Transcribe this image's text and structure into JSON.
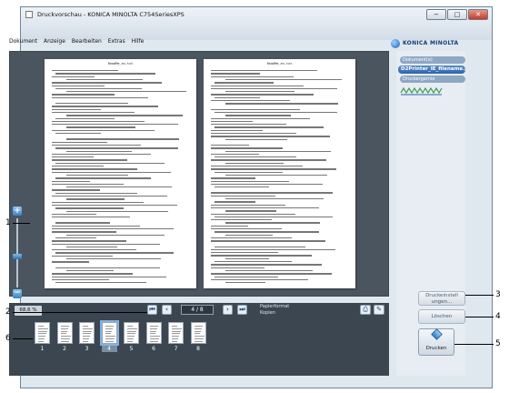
{
  "window": {
    "title": "Druckvorschau - KONICA MINOLTA C754SeriesXPS"
  },
  "window_buttons": {
    "minimize": "−",
    "maximize": "□",
    "close": "✕"
  },
  "menu": [
    "Dokument",
    "Anzeige",
    "Bearbeiten",
    "Extras",
    "Hilfe"
  ],
  "brand": {
    "logo_text": "KONICA MINOLTA"
  },
  "viewer": {
    "page_left": {
      "header": "ReadMe_en.txt"
    },
    "page_right": {
      "header": "ReadMe_en.txt"
    }
  },
  "zoom": {
    "plus": "+",
    "minus": "−",
    "readout": "68,6 %",
    "level_fraction": 0.45
  },
  "navigation": {
    "first": "⏮",
    "prev": "‹",
    "page": "4 / 8",
    "next": "›",
    "last": "⏭",
    "paper_format": "Papierformat",
    "paper_size": "Kopien"
  },
  "thumbnails": [
    {
      "num": "1",
      "selected": false
    },
    {
      "num": "2",
      "selected": false
    },
    {
      "num": "3",
      "selected": false
    },
    {
      "num": "4",
      "selected": true
    },
    {
      "num": "5",
      "selected": false
    },
    {
      "num": "6",
      "selected": false
    },
    {
      "num": "7",
      "selected": false
    },
    {
      "num": "8",
      "selected": false
    }
  ],
  "right_panel": {
    "documents_label": "Dokument(e)",
    "file_name": "D2Printer_IE_filename.pdf",
    "stamp_label": "Druckergarnie"
  },
  "actions": {
    "reset_settings": "Druckeinstell ungen...",
    "delete": "Löschen",
    "print": "Drucken"
  },
  "callouts": [
    "1",
    "2",
    "3",
    "4",
    "5",
    "6"
  ],
  "colors": {
    "accent": "#2f64a8",
    "dark_panel": "#3b4650",
    "window_bg": "#dfe7ef"
  }
}
